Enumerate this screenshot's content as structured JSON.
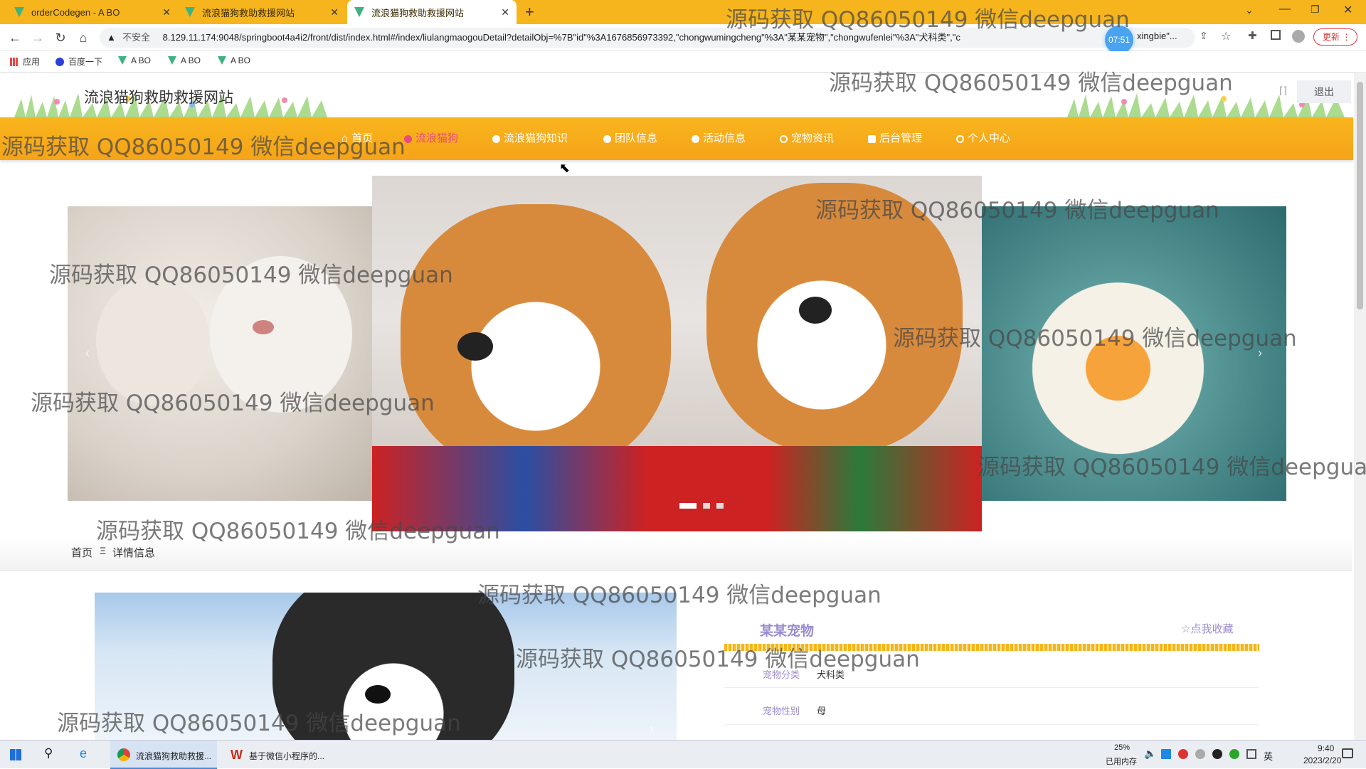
{
  "browser": {
    "tabs": [
      {
        "title": "orderCodegen - A BO",
        "active": false
      },
      {
        "title": "流浪猫狗救助救援网站",
        "active": false
      },
      {
        "title": "流浪猫狗救助救援网站",
        "active": true
      }
    ],
    "security_label": "不安全",
    "url": "8.129.11.174:9048/springboot4a4i2/front/dist/index.html#/index/liulangmaogouDetail?detailObj=%7B\"id\"%3A1676856973392,\"chongwumingcheng\"%3A\"某某宠物\",\"chongwufenlei\"%3A\"犬科类\",\"c",
    "url_tail": "xingbie\"...",
    "timer_badge": "07:51",
    "update_button": "更新",
    "bookmarks": [
      "应用",
      "百度一下",
      "A BO",
      "A BO",
      "A BO"
    ]
  },
  "site": {
    "title": "流浪猫狗救助救援网站",
    "logout": "退出",
    "nav": [
      {
        "label": "首页",
        "active": false
      },
      {
        "label": "流浪猫狗",
        "active": true
      },
      {
        "label": "流浪猫狗知识",
        "active": false
      },
      {
        "label": "团队信息",
        "active": false
      },
      {
        "label": "活动信息",
        "active": false
      },
      {
        "label": "宠物资讯",
        "active": false
      },
      {
        "label": "后台管理",
        "active": false
      },
      {
        "label": "个人中心",
        "active": false
      }
    ],
    "breadcrumb": {
      "home": "首页",
      "separator": "Ξ",
      "current": "详情信息"
    },
    "detail": {
      "name": "某某宠物",
      "favorite": "☆点我收藏",
      "fields": [
        {
          "label": "宠物分类",
          "value": "犬科类"
        },
        {
          "label": "宠物性别",
          "value": "母"
        }
      ]
    }
  },
  "watermark": "源码获取 QQ86050149 微信deepguan",
  "taskbar": {
    "apps": [
      "流浪猫狗救助救援...",
      "基于微信小程序的..."
    ],
    "memory_percent": "25%",
    "memory_label": "已用内存",
    "ime": "英",
    "time": "9:40",
    "date": "2023/2/20"
  },
  "colors": {
    "accent": "#f6a318",
    "nav_active_text": "#e84a7f",
    "detail_label": "#9b8bd0"
  }
}
